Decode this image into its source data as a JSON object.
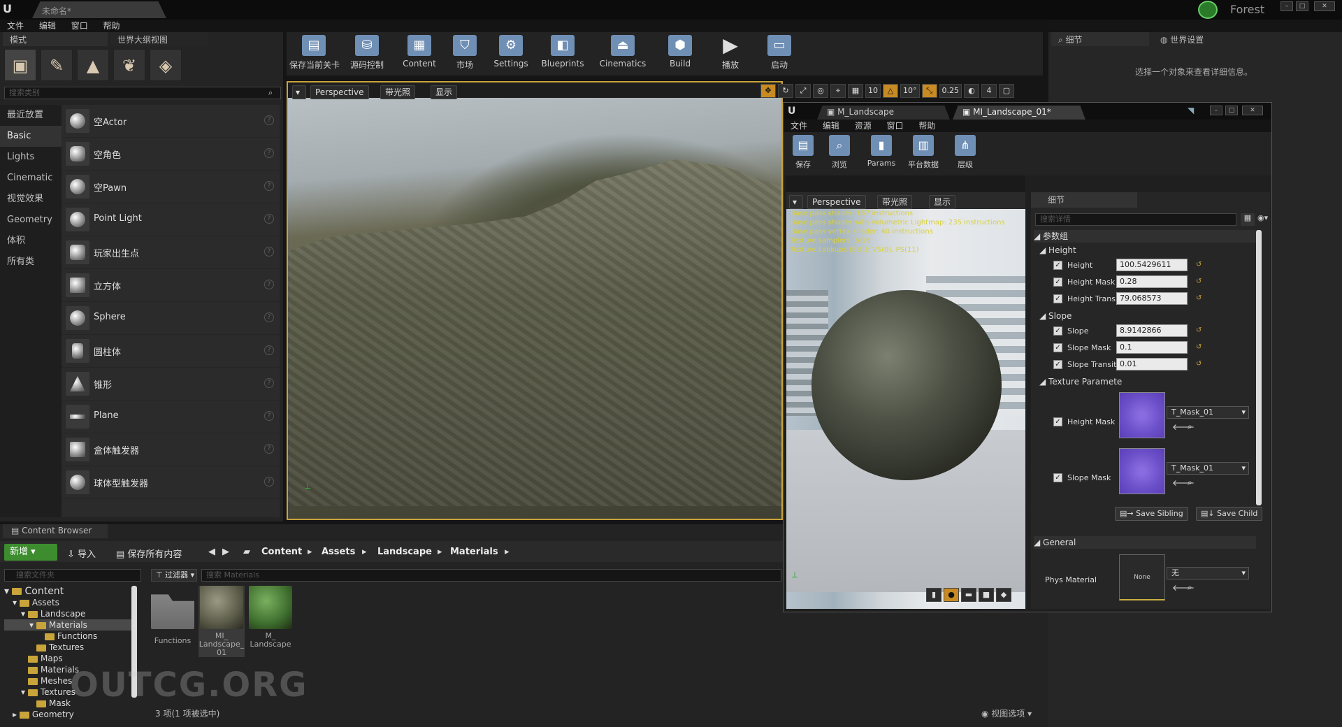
{
  "titlebar": {
    "doc_tab": "未命名*",
    "user": "Forest"
  },
  "menu": [
    "文件",
    "编辑",
    "窗口",
    "帮助"
  ],
  "left_tabs": {
    "modes": "模式",
    "outliner": "世界大纲视图"
  },
  "search_class_placeholder": "搜索类别",
  "categories": [
    "最近放置",
    "Basic",
    "Lights",
    "Cinematic",
    "视觉效果",
    "Geometry",
    "体积",
    "所有类"
  ],
  "place_items": [
    "空Actor",
    "空角色",
    "空Pawn",
    "Point Light",
    "玩家出生点",
    "立方体",
    "Sphere",
    "圆柱体",
    "锥形",
    "Plane",
    "盒体触发器",
    "球体型触发器"
  ],
  "toolbar": [
    "保存当前关卡",
    "源码控制",
    "Content",
    "市场",
    "Settings",
    "Blueprints",
    "Cinematics",
    "Build",
    "播放",
    "启动"
  ],
  "viewport": {
    "perspective": "Perspective",
    "lit": "带光照",
    "show": "显示",
    "grid": "10",
    "angle": "10°",
    "scale": "0.25",
    "speed": "4"
  },
  "right_panel": {
    "tab_details": "细节",
    "tab_world": "世界设置",
    "hint": "选择一个对象来查看详细信息。"
  },
  "content_browser": {
    "tab": "Content Browser",
    "new": "新增",
    "import": "导入",
    "save_all": "保存所有内容",
    "breadcrumbs": [
      "Content",
      "Assets",
      "Landscape",
      "Materials"
    ],
    "folder_search": "搜索文件夹",
    "filter": "过滤器",
    "search": "搜索 Materials",
    "tree": [
      "Content",
      "Assets",
      "Landscape",
      "Materials",
      "Functions",
      "Textures",
      "Maps",
      "Materials",
      "Meshes",
      "Textures",
      "Mask",
      "Geometry"
    ],
    "assets": [
      "Functions",
      "MI_ Landscape_ 01",
      "M_ Landscape"
    ],
    "count": "3 项(1 项被选中)",
    "view_options": "视图选项"
  },
  "watermark": "OUTCG.ORG",
  "material_editor": {
    "tabs": [
      "M_Landscape",
      "MI_Landscape_01*"
    ],
    "menu": [
      "文件",
      "编辑",
      "资源",
      "窗口",
      "帮助"
    ],
    "toolbar": [
      "保存",
      "浏览",
      "Params",
      "平台数据",
      "层级"
    ],
    "vp": {
      "perspective": "Perspective",
      "lit": "带光照",
      "show": "显示"
    },
    "stats": [
      "Base pass shader: 157 instructions",
      "Base pass shader with Volumetric Lightmap: 235 instructions",
      "Base pass vertex shader: 40 instructions",
      "Texture samplers: 6/16",
      "Texture Lookups (Est.): VS(0), PS(11)"
    ],
    "details_tab": "细节",
    "details_search": "搜索详情",
    "group": "参数组",
    "height_group": "Height",
    "height_params": [
      {
        "label": "Height",
        "value": "100.5429611"
      },
      {
        "label": "Height Mask",
        "value": "0.28"
      },
      {
        "label": "Height Trans",
        "value": "79.068573"
      }
    ],
    "slope_group": "Slope",
    "slope_params": [
      {
        "label": "Slope",
        "value": "8.9142866"
      },
      {
        "label": "Slope Mask",
        "value": "0.1"
      },
      {
        "label": "Slope Transit",
        "value": "0.01"
      }
    ],
    "texture_group": "Texture Paramete",
    "texture_params": [
      {
        "label": "Height Mask",
        "value": "T_Mask_01"
      },
      {
        "label": "Slope Mask",
        "value": "T_Mask_01"
      }
    ],
    "save_sibling": "Save Sibling",
    "save_child": "Save Child",
    "general": "General",
    "phys_label": "Phys Material",
    "phys_thumb": "None",
    "phys_value": "无"
  }
}
